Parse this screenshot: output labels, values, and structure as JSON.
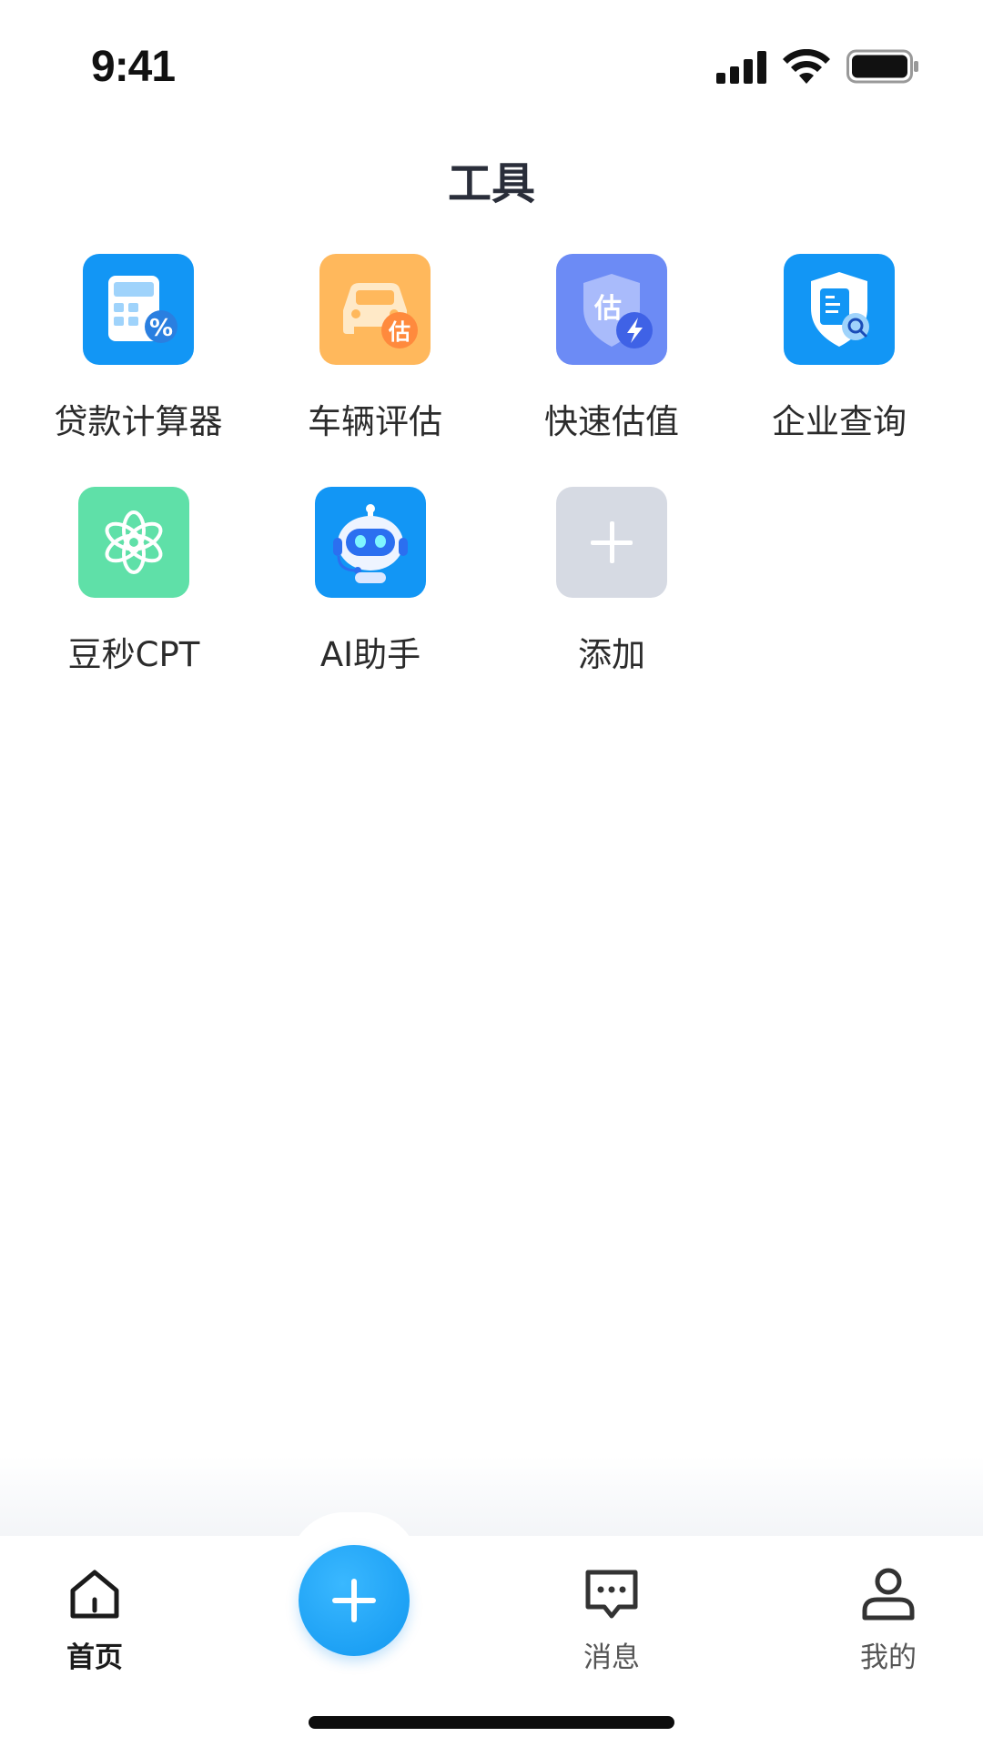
{
  "status_bar": {
    "time": "9:41",
    "icons": [
      "signal-icon",
      "wifi-icon",
      "battery-icon"
    ]
  },
  "page": {
    "title": "工具"
  },
  "tools": [
    {
      "label": "贷款计算器",
      "icon": "calculator-icon",
      "color": "#1296f5"
    },
    {
      "label": "车辆评估",
      "icon": "car-valuation-icon",
      "color": "#ffb85c",
      "badge": "估"
    },
    {
      "label": "快速估值",
      "icon": "shield-flash-icon",
      "color": "#6c8bf5",
      "badge": "估"
    },
    {
      "label": "企业查询",
      "icon": "enterprise-search-icon",
      "color": "#1296f5"
    },
    {
      "label": "豆秒CPT",
      "icon": "openai-knot-icon",
      "color": "#5fe0a8"
    },
    {
      "label": "AI助手",
      "icon": "robot-icon",
      "color": "#1296f5"
    },
    {
      "label": "添加",
      "icon": "plus-icon",
      "color": "#d6dae3"
    }
  ],
  "bottom_nav": {
    "items": [
      {
        "label": "首页",
        "icon": "home-icon",
        "active": true
      },
      {
        "label": "消息",
        "icon": "message-icon",
        "active": false
      },
      {
        "label": "我的",
        "icon": "user-icon",
        "active": false
      }
    ],
    "center_button": {
      "icon": "plus-icon",
      "color": "#1a9ff2"
    }
  }
}
